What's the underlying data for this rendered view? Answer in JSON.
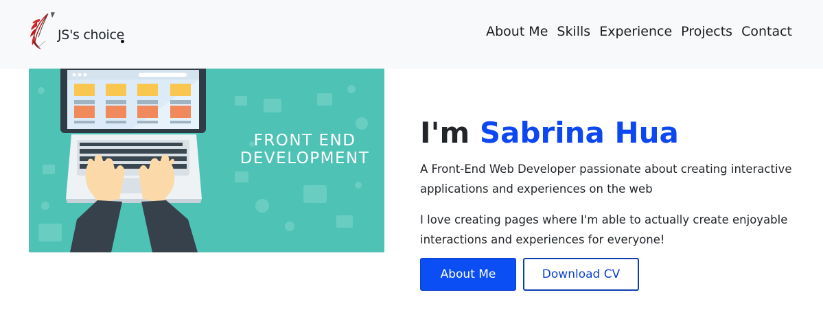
{
  "brand": {
    "text": "JS's choice",
    "logo_icon": "quill-pen-logo-icon"
  },
  "nav": {
    "items": [
      {
        "label": "About Me"
      },
      {
        "label": "Skills"
      },
      {
        "label": "Experience"
      },
      {
        "label": "Projects"
      },
      {
        "label": "Contact"
      }
    ]
  },
  "hero_image": {
    "caption_line1": "FRONT END",
    "caption_line2": "DEVELOPMENT",
    "background_color": "#4fc2b6"
  },
  "hero": {
    "greeting": "I'm",
    "name": "Sabrina Hua",
    "paragraph1": "A Front-End Web Developer passionate about creating interactive applications and experiences on the web",
    "paragraph2": "I love creating pages where I'm able to actually create enjoyable interactions and experiences for everyone!"
  },
  "buttons": {
    "primary_label": "About Me",
    "secondary_label": "Download CV"
  },
  "colors": {
    "accent": "#0b4ef3",
    "name_color": "#0d47f0",
    "navbar_bg": "#f8f9fa"
  }
}
